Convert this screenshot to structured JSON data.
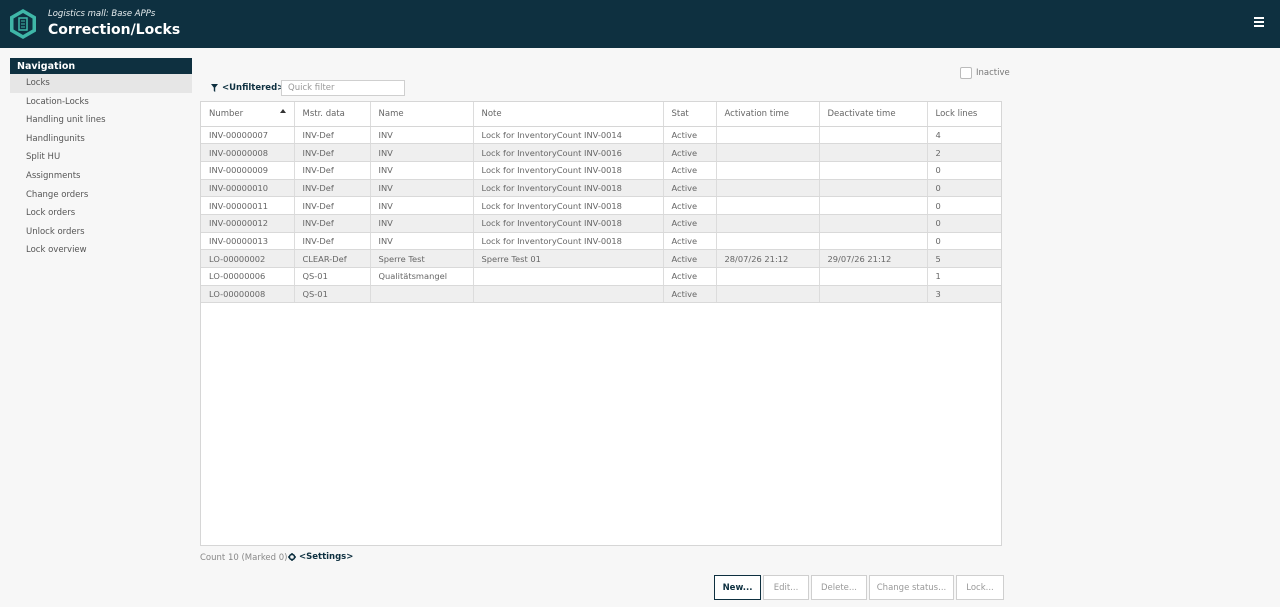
{
  "header": {
    "subtitle": "Logistics mall: Base APPs",
    "title": "Correction/Locks"
  },
  "navigation": {
    "title": "Navigation",
    "items": [
      {
        "label": "Locks",
        "active": true
      },
      {
        "label": "Location-Locks"
      },
      {
        "label": "Handling unit lines"
      },
      {
        "label": "Handlingunits"
      },
      {
        "label": "Split HU"
      },
      {
        "label": "Assignments"
      },
      {
        "label": "Change orders"
      },
      {
        "label": "Lock orders"
      },
      {
        "label": "Unlock orders"
      },
      {
        "label": "Lock overview"
      }
    ]
  },
  "toolbar": {
    "filter_label": "<Unfiltered>",
    "quick_filter_placeholder": "Quick filter",
    "inactive_label": "Inactive"
  },
  "table": {
    "columns": [
      "Number",
      "Mstr. data",
      "Name",
      "Note",
      "Stat",
      "Activation time",
      "Deactivate time",
      "Lock lines"
    ],
    "rows": [
      [
        "INV-00000007",
        "INV-Def",
        "INV",
        "Lock for InventoryCount INV-0014",
        "Active",
        "",
        "",
        "4"
      ],
      [
        "INV-00000008",
        "INV-Def",
        "INV",
        "Lock for InventoryCount INV-0016",
        "Active",
        "",
        "",
        "2"
      ],
      [
        "INV-00000009",
        "INV-Def",
        "INV",
        "Lock for InventoryCount INV-0018",
        "Active",
        "",
        "",
        "0"
      ],
      [
        "INV-00000010",
        "INV-Def",
        "INV",
        "Lock for InventoryCount INV-0018",
        "Active",
        "",
        "",
        "0"
      ],
      [
        "INV-00000011",
        "INV-Def",
        "INV",
        "Lock for InventoryCount INV-0018",
        "Active",
        "",
        "",
        "0"
      ],
      [
        "INV-00000012",
        "INV-Def",
        "INV",
        "Lock for InventoryCount INV-0018",
        "Active",
        "",
        "",
        "0"
      ],
      [
        "INV-00000013",
        "INV-Def",
        "INV",
        "Lock for InventoryCount INV-0018",
        "Active",
        "",
        "",
        "0"
      ],
      [
        "LO-00000002",
        "CLEAR-Def",
        "Sperre Test",
        "Sperre Test 01",
        "Active",
        "28/07/26 21:12",
        "29/07/26 21:12",
        "5"
      ],
      [
        "LO-00000006",
        "QS-01",
        "Qualitätsmangel",
        "",
        "Active",
        "",
        "",
        "1"
      ],
      [
        "LO-00000008",
        "QS-01",
        "",
        "",
        "Active",
        "",
        "",
        "3"
      ]
    ]
  },
  "footer": {
    "count_text": "Count 10 (Marked 0)",
    "settings_label": "<Settings>"
  },
  "buttons": {
    "new": "New...",
    "edit": "Edit...",
    "delete": "Delete...",
    "change_status": "Change status...",
    "lock": "Lock..."
  }
}
